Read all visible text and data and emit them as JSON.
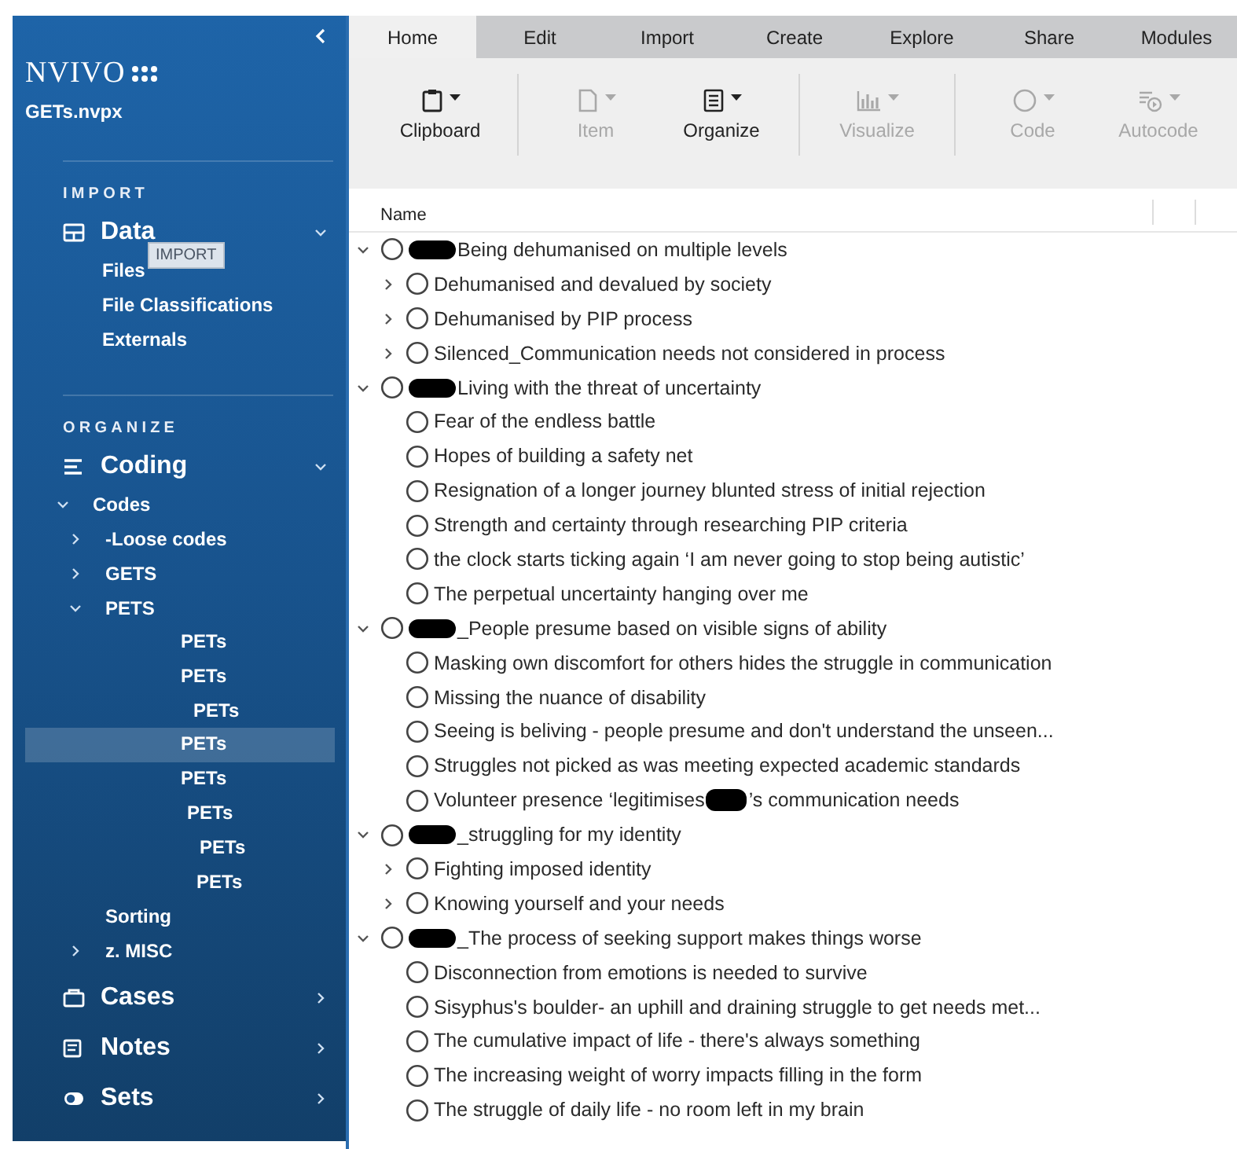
{
  "sidebar": {
    "logo": "NVIVO",
    "project": "GETs.nvpx",
    "tooltip": "IMPORT",
    "sections": [
      {
        "title": "IMPORT",
        "items": [
          {
            "label": "Data",
            "kind": "data",
            "expanded": true,
            "children": [
              {
                "label": "Files"
              },
              {
                "label": "File Classifications"
              },
              {
                "label": "Externals"
              }
            ]
          }
        ]
      },
      {
        "title": "ORGANIZE",
        "items": [
          {
            "label": "Coding",
            "kind": "coding",
            "expanded": true,
            "codes": {
              "label": "Codes",
              "expanded": true,
              "children": [
                {
                  "label": "-Loose codes",
                  "kind": "folder",
                  "expanded": false
                },
                {
                  "label": "GETS",
                  "kind": "folder",
                  "expanded": false
                },
                {
                  "label": "PETS",
                  "kind": "folder",
                  "expanded": true,
                  "children": [
                    {
                      "label": "PETs",
                      "selected": false
                    },
                    {
                      "label": "PETs",
                      "selected": false
                    },
                    {
                      "label": "PETs",
                      "selected": false
                    },
                    {
                      "label": "PETs",
                      "selected": true
                    },
                    {
                      "label": "PETs",
                      "selected": false
                    },
                    {
                      "label": "PETs",
                      "selected": false
                    },
                    {
                      "label": "PETs",
                      "selected": false
                    },
                    {
                      "label": "PETs",
                      "selected": false
                    }
                  ]
                },
                {
                  "label": "Sorting",
                  "kind": "leaf"
                },
                {
                  "label": "z. MISC",
                  "kind": "folder",
                  "expanded": false
                }
              ]
            }
          },
          {
            "label": "Cases",
            "kind": "cases",
            "expanded": false
          },
          {
            "label": "Notes",
            "kind": "notes",
            "expanded": false
          },
          {
            "label": "Sets",
            "kind": "sets",
            "expanded": false
          }
        ]
      }
    ]
  },
  "tabs": [
    {
      "label": "Home",
      "selected": true
    },
    {
      "label": "Edit",
      "selected": false
    },
    {
      "label": "Import",
      "selected": false
    },
    {
      "label": "Create",
      "selected": false
    },
    {
      "label": "Explore",
      "selected": false
    },
    {
      "label": "Share",
      "selected": false
    },
    {
      "label": "Modules",
      "selected": false
    }
  ],
  "ribbon": [
    {
      "label": "Clipboard",
      "kind": "clipboard",
      "disabled": false,
      "separator_after": true
    },
    {
      "label": "Item",
      "kind": "document",
      "disabled": true,
      "separator_after": false
    },
    {
      "label": "Organize",
      "kind": "list",
      "disabled": false,
      "separator_after": true
    },
    {
      "label": "Visualize",
      "kind": "chart",
      "disabled": true,
      "separator_after": true
    },
    {
      "label": "Code",
      "kind": "circle",
      "disabled": true,
      "separator_after": false
    },
    {
      "label": "Autocode",
      "kind": "autocode",
      "disabled": true,
      "separator_after": false
    }
  ],
  "table": {
    "columns": [
      "Name"
    ],
    "nodes": [
      {
        "label": "Being dehumanised on multiple levels",
        "redacted": true,
        "kind": "group",
        "expanded": true,
        "children": [
          {
            "label": "Dehumanised and devalued by society",
            "redacted": false,
            "kind": "group",
            "expanded": false
          },
          {
            "label": "Dehumanised by PIP process",
            "redacted": false,
            "kind": "group",
            "expanded": false
          },
          {
            "label": "Silenced_Communication needs not considered in process",
            "redacted": false,
            "kind": "group",
            "expanded": false
          }
        ]
      },
      {
        "label": "Living with the threat of uncertainty",
        "redacted": true,
        "kind": "group",
        "expanded": true,
        "children": [
          {
            "label": "Fear of the endless battle",
            "redacted": false,
            "kind": "leaf"
          },
          {
            "label": "Hopes of building a safety net",
            "redacted": false,
            "kind": "leaf"
          },
          {
            "label": "Resignation of a longer journey blunted stress of initial rejection",
            "redacted": false,
            "kind": "leaf"
          },
          {
            "label": "Strength and certainty through researching PIP criteria",
            "redacted": false,
            "kind": "leaf"
          },
          {
            "label": "the clock starts ticking again ‘I am never going to stop being autistic’",
            "redacted": false,
            "kind": "leaf"
          },
          {
            "label": "The perpetual uncertainty hanging over me",
            "redacted": false,
            "kind": "leaf"
          }
        ]
      },
      {
        "label": "_People presume based on visible signs of ability",
        "redacted": true,
        "kind": "group",
        "expanded": true,
        "children": [
          {
            "label": "Masking own discomfort for others hides the struggle in communication",
            "redacted": false,
            "kind": "leaf"
          },
          {
            "label": "Missing the nuance of disability",
            "redacted": false,
            "kind": "leaf"
          },
          {
            "label": "Seeing is beliving - people presume and don't understand the unseen...",
            "redacted": false,
            "kind": "leaf"
          },
          {
            "label": "Struggles not picked as was meeting expected academic standards",
            "redacted": false,
            "kind": "leaf"
          },
          {
            "label": "Volunteer presence ‘legitimises",
            "label_after": "’s communication needs",
            "redacted": true,
            "kind": "leaf"
          }
        ]
      },
      {
        "label": "_struggling for my identity",
        "redacted": true,
        "kind": "group",
        "expanded": true,
        "children": [
          {
            "label": "Fighting imposed identity",
            "redacted": false,
            "kind": "group",
            "expanded": false
          },
          {
            "label": "Knowing yourself and your needs",
            "redacted": false,
            "kind": "group",
            "expanded": false
          }
        ]
      },
      {
        "label": "_The process of seeking support makes things worse",
        "redacted": true,
        "kind": "group",
        "expanded": true,
        "children": [
          {
            "label": "Disconnection from emotions is needed to survive",
            "redacted": false,
            "kind": "leaf"
          },
          {
            "label": "Sisyphus's boulder- an uphill and draining struggle to get needs met...",
            "redacted": false,
            "kind": "leaf"
          },
          {
            "label": "The cumulative impact of life - there's always something",
            "redacted": false,
            "kind": "leaf"
          },
          {
            "label": "The increasing weight of worry impacts filling in the form",
            "redacted": false,
            "kind": "leaf"
          },
          {
            "label": "The struggle of daily life - no room left in my brain",
            "redacted": false,
            "kind": "leaf"
          }
        ]
      }
    ]
  }
}
